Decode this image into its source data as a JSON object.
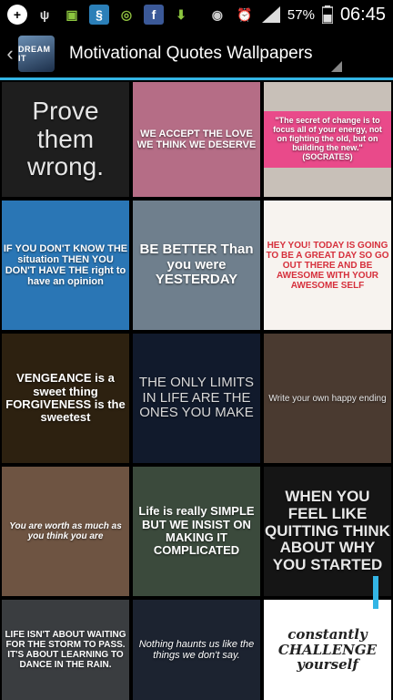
{
  "status_bar": {
    "battery_percent": "57%",
    "time": "06:45",
    "icons": [
      "add-icon",
      "usb-icon",
      "android-debug-icon",
      "browser-icon",
      "planet-icon",
      "facebook-icon",
      "download-icon",
      "eye-icon",
      "alarm-icon",
      "signal-icon",
      "battery-icon"
    ]
  },
  "app_bar": {
    "title": "Motivational Quotes Wallpapers",
    "icon_label": "DREAM IT",
    "back_glyph": "‹"
  },
  "accent_color": "#33b5e5",
  "wallpapers": [
    {
      "text": "Prove them wrong.",
      "bg": "#1e1e1e",
      "fg": "#e6e6e6"
    },
    {
      "text": "WE ACCEPT THE LOVE WE THINK WE DESERVE",
      "bg": "#b56d86",
      "fg": "#ffffff"
    },
    {
      "text": "\"The secret of change is to focus all of your energy, not on fighting the old, but on building the new.\" (SOCRATES)",
      "bg": "#c8c0b8",
      "fg": "#ffffff"
    },
    {
      "text": "IF YOU DON'T KNOW THE situation THEN YOU DON'T HAVE THE right to have an opinion",
      "bg": "#2a76b5",
      "fg": "#ffffff"
    },
    {
      "text": "BE BETTER Than you were YESTERDAY",
      "bg": "#6f7f8d",
      "fg": "#ffffff"
    },
    {
      "text": "HEY YOU! TODAY IS GOING TO BE A GREAT DAY SO GO OUT THERE AND BE AWESOME WITH YOUR AWESOME SELF",
      "bg": "#f7f3ef",
      "fg": "#d6303c"
    },
    {
      "text": "VENGEANCE is a sweet thing FORGIVENESS is the sweetest",
      "bg": "#2d2110",
      "fg": "#ffffff"
    },
    {
      "text": "THE ONLY LIMITS IN LIFE ARE THE ONES YOU MAKE",
      "bg": "#111a2c",
      "fg": "#d8d8d8"
    },
    {
      "text": "Write your own happy ending",
      "bg": "#4a3a30",
      "fg": "#e6e6e6"
    },
    {
      "text": "You are worth as much as you think you are",
      "bg": "#6e5442",
      "fg": "#ffffff"
    },
    {
      "text": "Life is really SIMPLE BUT WE INSIST ON MAKING IT COMPLICATED",
      "bg": "#3b4a3c",
      "fg": "#ffffff"
    },
    {
      "text": "WHEN YOU FEEL LIKE QUITTING THINK ABOUT WHY YOU STARTED",
      "bg": "#151515",
      "fg": "#e8e8e8"
    },
    {
      "text": "LIFE ISN'T ABOUT WAITING FOR THE STORM TO PASS. IT'S ABOUT LEARNING TO DANCE IN THE RAIN.",
      "bg": "#3a3d40",
      "fg": "#ffffff"
    },
    {
      "text": "Nothing haunts us like the things we don't say.",
      "bg": "#1c2330",
      "fg": "#ffffff"
    },
    {
      "text": "constantly CHALLENGE yourself",
      "bg": "#ffffff",
      "fg": "#222222"
    }
  ]
}
